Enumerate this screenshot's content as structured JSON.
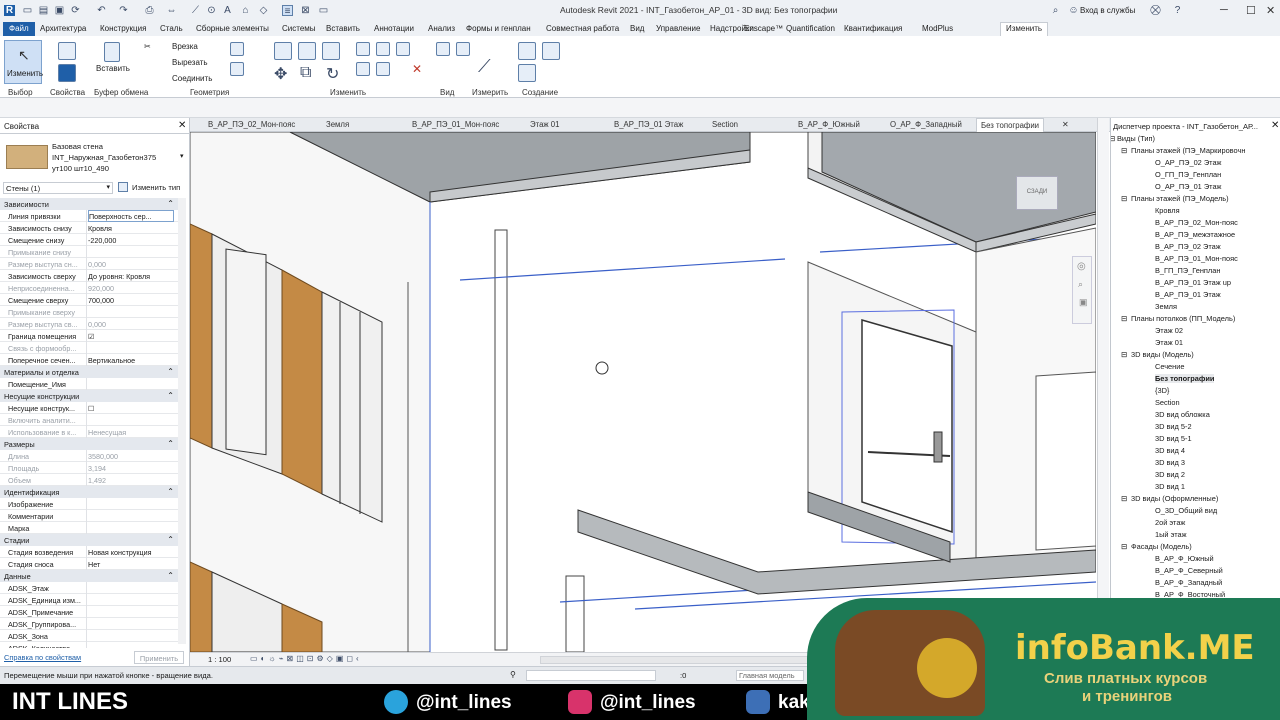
{
  "window": {
    "title": "Autodesk Revit 2021 - INT_Газобетон_АР_01 - 3D вид: Без топографии",
    "sign_in": "Вход в службы",
    "help": "?"
  },
  "ribbon_tabs": [
    "Файл",
    "Архитектура",
    "Конструкция",
    "Сталь",
    "Сборные элементы",
    "Системы",
    "Вставить",
    "Аннотации",
    "Анализ",
    "Формы и генплан",
    "Совместная работа",
    "Вид",
    "Управление",
    "Надстройки",
    "Enscape™",
    "Quantification",
    "Квантификация",
    "ModPlus",
    "Изменить"
  ],
  "ribbon": {
    "modify_label": "Изменить",
    "paste_label": "Вставить",
    "cut_label": "Вырезать",
    "cope_label": "Врезка",
    "join_label": "Соединить",
    "panels": [
      "Выбор",
      "Свойства",
      "Буфер обмена",
      "Геометрия",
      "Изменить",
      "Вид",
      "Измерить",
      "Создание"
    ]
  },
  "properties": {
    "header": "Свойства",
    "type_family": "Базовая стена",
    "type_name": "INT_Наружная_Газобетон375",
    "type_name2": "ут100 шт10_490",
    "selector": "Стены (1)",
    "edit_type": "Изменить тип",
    "help_link": "Справка по свойствам",
    "apply": "Применить",
    "rows": [
      {
        "g": true,
        "k": "Зависимости"
      },
      {
        "k": "Линия привязки",
        "v": "Поверхность сер..."
      },
      {
        "k": "Зависимость снизу",
        "v": "Кровля"
      },
      {
        "k": "Смещение снизу",
        "v": "-220,000"
      },
      {
        "k": "Примыкание снизу",
        "v": "",
        "d": true
      },
      {
        "k": "Размер выступа сн...",
        "v": "0,000",
        "d": true
      },
      {
        "k": "Зависимость сверху",
        "v": "До уровня: Кровля"
      },
      {
        "k": "Неприсоединенна...",
        "v": "920,000",
        "d": true
      },
      {
        "k": "Смещение сверху",
        "v": "700,000"
      },
      {
        "k": "Примыкание сверху",
        "v": "",
        "d": true
      },
      {
        "k": "Размер выступа св...",
        "v": "0,000",
        "d": true
      },
      {
        "k": "Граница помещения",
        "v": "☑"
      },
      {
        "k": "Связь с формообр...",
        "v": "",
        "d": true
      },
      {
        "k": "Поперечное сечен...",
        "v": "Вертикальное"
      },
      {
        "g": true,
        "k": "Материалы и отделка"
      },
      {
        "k": "Помещение_Имя",
        "v": ""
      },
      {
        "g": true,
        "k": "Несущие конструкции"
      },
      {
        "k": "Несущие конструк...",
        "v": "☐"
      },
      {
        "k": "Включить аналити...",
        "v": "",
        "d": true
      },
      {
        "k": "Использование в к...",
        "v": "Ненесущая",
        "d": true
      },
      {
        "g": true,
        "k": "Размеры"
      },
      {
        "k": "Длина",
        "v": "3580,000",
        "d": true
      },
      {
        "k": "Площадь",
        "v": "3,194",
        "d": true
      },
      {
        "k": "Объем",
        "v": "1,492",
        "d": true
      },
      {
        "g": true,
        "k": "Идентификация"
      },
      {
        "k": "Изображение",
        "v": ""
      },
      {
        "k": "Комментарии",
        "v": ""
      },
      {
        "k": "Марка",
        "v": ""
      },
      {
        "g": true,
        "k": "Стадии"
      },
      {
        "k": "Стадия возведения",
        "v": "Новая конструкция"
      },
      {
        "k": "Стадия сноса",
        "v": "Нет"
      },
      {
        "g": true,
        "k": "Данные"
      },
      {
        "k": "ADSK_Этаж",
        "v": ""
      },
      {
        "k": "ADSK_Единица изм...",
        "v": ""
      },
      {
        "k": "ADSK_Примечание",
        "v": ""
      },
      {
        "k": "ADSK_Группирова...",
        "v": ""
      },
      {
        "k": "ADSK_Зона",
        "v": ""
      },
      {
        "k": "ADSK_Количество",
        "v": ""
      }
    ]
  },
  "view_tabs": [
    "В_АР_ПЭ_02_Мон-пояс",
    "Земля",
    "В_АР_ПЭ_01_Мон-пояс",
    "Этаж 01",
    "В_АР_ПЭ_01 Этаж",
    "Section",
    "В_АР_Ф_Южный",
    "О_АР_Ф_Западный",
    "Без топографии"
  ],
  "view_bar": {
    "scale": "1 : 100"
  },
  "viewcube": {
    "face": "СЗАДИ"
  },
  "browser": {
    "header": "Диспетчер проекта - INT_Газобетон_АР...",
    "items": [
      {
        "l": 0,
        "t": "Виды (Тип)"
      },
      {
        "l": 1,
        "t": "Планы этажей (ПЭ_Маркировочн"
      },
      {
        "l": 2,
        "t": "О_АР_ПЭ_02 Этаж"
      },
      {
        "l": 2,
        "t": "О_ГП_ПЭ_Генплан"
      },
      {
        "l": 2,
        "t": "О_АР_ПЭ_01 Этаж"
      },
      {
        "l": 1,
        "t": "Планы этажей (ПЭ_Модель)"
      },
      {
        "l": 2,
        "t": "Кровля"
      },
      {
        "l": 2,
        "t": "В_АР_ПЭ_02_Мон-пояс"
      },
      {
        "l": 2,
        "t": "В_АР_ПЭ_межэтажное"
      },
      {
        "l": 2,
        "t": "В_АР_ПЭ_02 Этаж"
      },
      {
        "l": 2,
        "t": "В_АР_ПЭ_01_Мон-пояс"
      },
      {
        "l": 2,
        "t": "В_ГП_ПЭ_Генплан"
      },
      {
        "l": 2,
        "t": "В_АР_ПЭ_01 Этаж up"
      },
      {
        "l": 2,
        "t": "В_АР_ПЭ_01 Этаж"
      },
      {
        "l": 2,
        "t": "Земля"
      },
      {
        "l": 1,
        "t": "Планы потолков (ПП_Модель)"
      },
      {
        "l": 2,
        "t": "Этаж 02"
      },
      {
        "l": 2,
        "t": "Этаж 01"
      },
      {
        "l": 1,
        "t": "3D виды (Модель)"
      },
      {
        "l": 2,
        "t": "Сечение"
      },
      {
        "l": 2,
        "t": "Без топографии",
        "sel": true
      },
      {
        "l": 2,
        "t": "{3D}"
      },
      {
        "l": 2,
        "t": "Section"
      },
      {
        "l": 2,
        "t": "3D вид обложка"
      },
      {
        "l": 2,
        "t": "3D вид 5-2"
      },
      {
        "l": 2,
        "t": "3D вид 5-1"
      },
      {
        "l": 2,
        "t": "3D вид 4"
      },
      {
        "l": 2,
        "t": "3D вид 3"
      },
      {
        "l": 2,
        "t": "3D вид 2"
      },
      {
        "l": 2,
        "t": "3D вид 1"
      },
      {
        "l": 1,
        "t": "3D виды (Оформленные)"
      },
      {
        "l": 2,
        "t": "О_3D_Общий вид"
      },
      {
        "l": 2,
        "t": "2ой этаж"
      },
      {
        "l": 2,
        "t": "1ый этаж"
      },
      {
        "l": 1,
        "t": "Фасады (Модель)"
      },
      {
        "l": 2,
        "t": "В_АР_Ф_Южный"
      },
      {
        "l": 2,
        "t": "В_АР_Ф_Северный"
      },
      {
        "l": 2,
        "t": "В_АР_Ф_Западный"
      },
      {
        "l": 2,
        "t": "В_АР_Ф_Восточный"
      }
    ]
  },
  "status": {
    "text": "Перемещение мыши при нажатой кнопке - вращение вида.",
    "zero": ":0",
    "model": "Главная модель"
  },
  "overlay": {
    "brand": "INT LINES",
    "tg": "@int_lines",
    "ig": "@int_lines",
    "vk": "kak_",
    "banner_title": "infoBank.ME",
    "banner_line1": "Слив платных курсов",
    "banner_line2": "и тренингов"
  },
  "colors": {
    "file_tab": "#1f5fa8",
    "accent": "#3a78c3",
    "banner": "#1d7a55",
    "banner_text": "#f2d14a"
  }
}
